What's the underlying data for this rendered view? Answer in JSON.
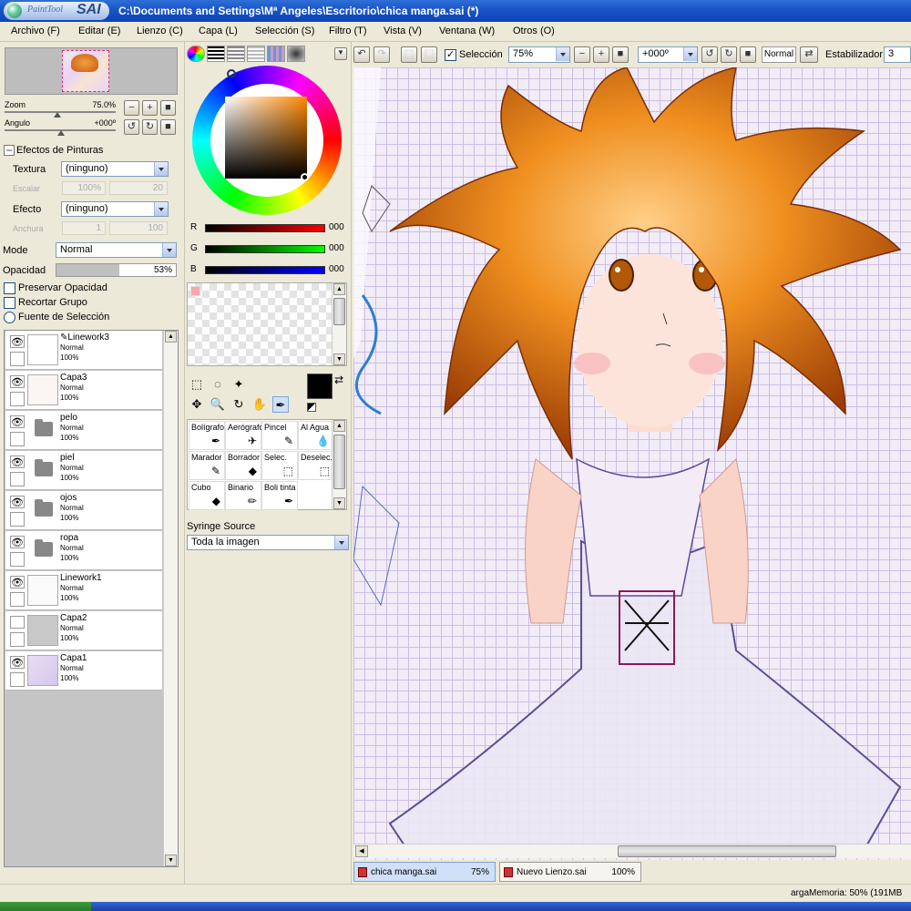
{
  "app": {
    "logo_small": "PaintTool",
    "logo_big": "SAI",
    "window_title": "C:\\Documents and Settings\\Mª Angeles\\Escritorio\\chica manga.sai (*)"
  },
  "menu": [
    "Archivo (F)",
    "Editar (E)",
    "Lienzo (C)",
    "Capa (L)",
    "Selección (S)",
    "Filtro (T)",
    "Vista (V)",
    "Ventana (W)",
    "Otros (O)"
  ],
  "navigator": {
    "zoom_label": "Zoom",
    "zoom_value": "75.0%",
    "angle_label": "Angulo",
    "angle_value": "+000º"
  },
  "paint_effects": {
    "header": "Efectos de Pinturas",
    "texture_label": "Textura",
    "texture_value": "(ninguno)",
    "scale_label": "Escalar",
    "scale_value": "100%",
    "scale_num": "20",
    "effect_label": "Efecto",
    "effect_value": "(ninguno)",
    "width_label": "Anchura",
    "width_value": "1",
    "width_num": "100"
  },
  "layer_props": {
    "mode_label": "Mode",
    "mode_value": "Normal",
    "opacity_label": "Opacidad",
    "opacity_value": "53%",
    "opacity_fraction": 0.53,
    "preserve": "Preservar Opacidad",
    "clip_group": "Recortar Grupo",
    "selection_source": "Fuente de Selección"
  },
  "layers": [
    {
      "name": "Linework3",
      "mode": "Normal",
      "opacity": "100%",
      "kind": "layer"
    },
    {
      "name": "Capa3",
      "mode": "Normal",
      "opacity": "100%",
      "kind": "layer"
    },
    {
      "name": "pelo",
      "mode": "Normal",
      "opacity": "100%",
      "kind": "folder"
    },
    {
      "name": "piel",
      "mode": "Normal",
      "opacity": "100%",
      "kind": "folder"
    },
    {
      "name": "ojos",
      "mode": "Normal",
      "opacity": "100%",
      "kind": "folder"
    },
    {
      "name": "ropa",
      "mode": "Normal",
      "opacity": "100%",
      "kind": "folder"
    },
    {
      "name": "Linework1",
      "mode": "Normal",
      "opacity": "100%",
      "kind": "layer"
    },
    {
      "name": "Capa2",
      "mode": "Normal",
      "opacity": "100%",
      "kind": "layer"
    },
    {
      "name": "Capa1",
      "mode": "Normal",
      "opacity": "100%",
      "kind": "layer"
    }
  ],
  "color": {
    "r_label": "R",
    "r_value": "000",
    "g_label": "G",
    "g_value": "000",
    "b_label": "B",
    "b_value": "000",
    "primary": "#000000",
    "secondary": "#ffffff"
  },
  "brushes": [
    {
      "label": "Bolígrafo",
      "icon": "pen-icon"
    },
    {
      "label": "Aerógrafo",
      "icon": "airbrush-icon"
    },
    {
      "label": "Pincel",
      "icon": "brush-icon"
    },
    {
      "label": "Al Agua",
      "icon": "water-icon"
    },
    {
      "label": "Marador",
      "icon": "marker-icon"
    },
    {
      "label": "Borrador",
      "icon": "eraser-icon"
    },
    {
      "label": "Selec.",
      "icon": "select-icon"
    },
    {
      "label": "Deselec.",
      "icon": "deselect-icon"
    },
    {
      "label": "Cubo",
      "icon": "bucket-icon"
    },
    {
      "label": "Binario",
      "icon": "binary-icon"
    },
    {
      "label": "Boli tinta",
      "icon": "ink-pen-icon"
    }
  ],
  "syringe": {
    "label": "Syringe Source",
    "value": "Toda la imagen"
  },
  "toolbar": {
    "selection_label": "Selección",
    "zoom": "75%",
    "angle": "+000º",
    "mode": "Normal",
    "stabilizer_label": "Estabilizador",
    "stabilizer_value": "3"
  },
  "documents": [
    {
      "name": "chica manga.sai",
      "zoom": "75%"
    },
    {
      "name": "Nuevo Lienzo.sai",
      "zoom": "100%"
    }
  ],
  "status": {
    "memory": "argaMemoria: 50% (191MB"
  }
}
